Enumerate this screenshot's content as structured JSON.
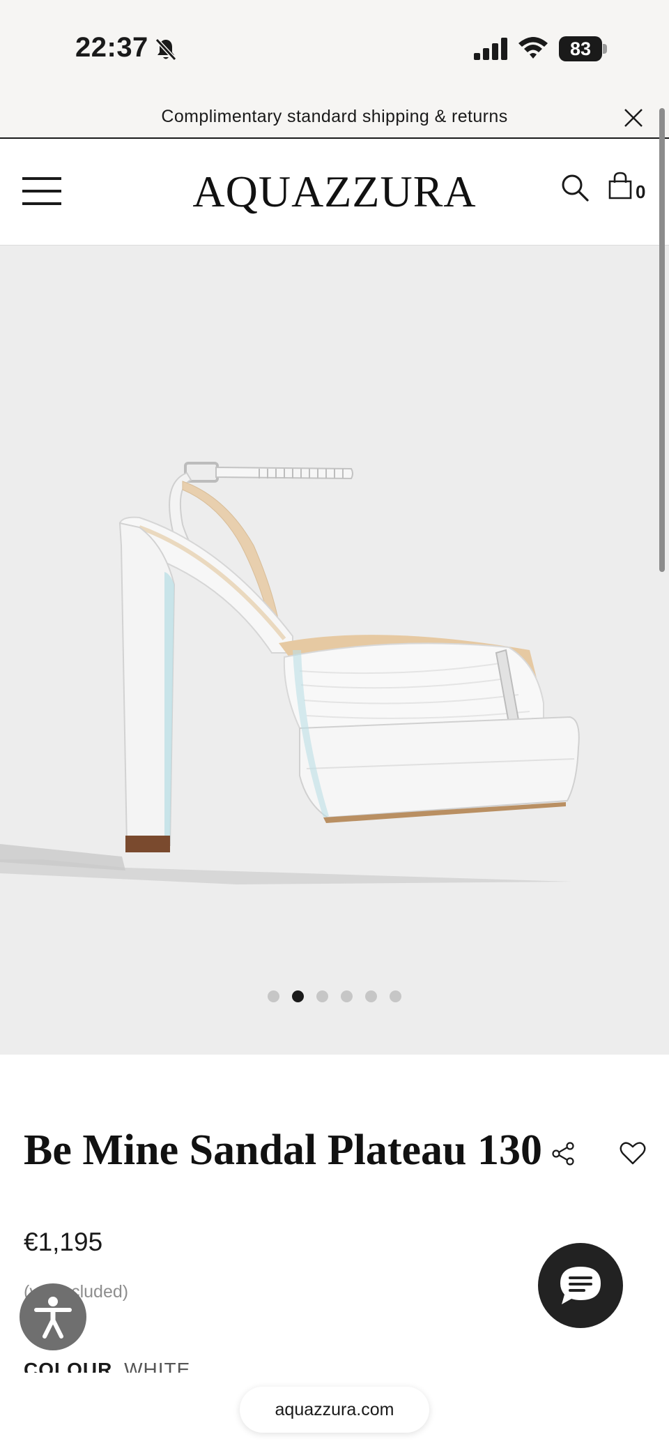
{
  "status_bar": {
    "time": "22:37",
    "battery_percent": "83",
    "icons": [
      "bell-muted-icon",
      "cellular-signal-icon",
      "wifi-icon",
      "battery-icon"
    ]
  },
  "promo": {
    "text": "Complimentary standard shipping & returns",
    "close_icon": "close-icon"
  },
  "header": {
    "brand": "AQUAZZURA",
    "cart_count": "0",
    "icons": [
      "hamburger-menu-icon",
      "search-icon",
      "shopping-bag-icon"
    ]
  },
  "gallery": {
    "image_subject": "white platform sandal with ankle strap",
    "slide_count": 6,
    "active_slide": 2
  },
  "product": {
    "title": "Be Mine Sandal Plateau 130",
    "price": "€1,195",
    "vat_note": "(vat included)",
    "colour_label": "COLOUR",
    "colour_value": "WHITE",
    "icons": [
      "share-icon",
      "heart-icon"
    ]
  },
  "floating": {
    "accessibility_icon": "accessibility-icon",
    "chat_icon": "chat-icon",
    "url": "aquazzura.com"
  },
  "colors": {
    "top_bar_bg": "#f6f5f3",
    "gallery_bg": "#ededed",
    "text": "#1a1a1a",
    "chat_bg": "#222222",
    "a11y_bg": "#6f6f6f"
  }
}
